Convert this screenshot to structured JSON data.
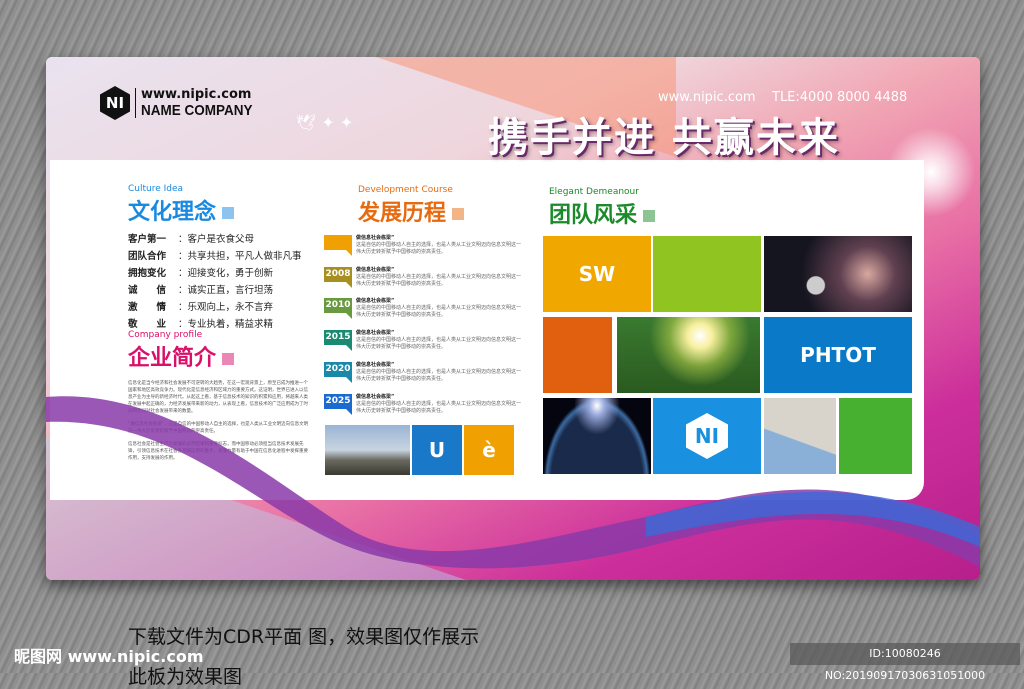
{
  "header": {
    "logo_mark": "NI",
    "website": "www.nipic.com",
    "company": "NAME COMPANY",
    "contact_site": "www.nipic.com",
    "tel": "TLE:4000 8000 4488",
    "slogan": "携手并进 共赢未来"
  },
  "culture": {
    "en": "Culture Idea",
    "title": "文化理念",
    "items": [
      {
        "k": "客户第一",
        "v": "：客户是衣食父母"
      },
      {
        "k": "团队合作",
        "v": "：共享共担，平凡人做非凡事"
      },
      {
        "k": "拥抱变化",
        "v": "：迎接变化，勇于创新"
      },
      {
        "k": "诚　　信",
        "v": "：诚实正直，言行坦荡"
      },
      {
        "k": "激　　情",
        "v": "：乐观向上，永不言弃"
      },
      {
        "k": "敬　　业",
        "v": "：专业执着，精益求精"
      }
    ]
  },
  "profile": {
    "en": "Company profile",
    "title": "企业简介",
    "paras": [
      "信息化是当今经济和社会发展不可逆转的大趋势，在这一宏观背景上，原至已成为推进一个国家和地区高效竞争力。现代化是信息经济和区域力的重要方式。这证明，世界已进入以信息产业为主导的新经济时代。从起这上看，基于信息技术的知识的积累和应用，将越来人类在发展中起正确的，力经济发展带来新的动力，从表现上看，信息技术的广泛应用成为了时间和空间对社会发展带来的数量。",
      "“做信息社会栋梁”，这是自信的中国移动人自主的选择，也是人类从工业文明迈向信息文明这一伟大历史转折赋予中国移动的崇高责任。",
      "信息社会是社会生产力发展的必然结果和重要标志，而中国移动必须担当信息技术发展先锋，引领信息技术在社会各领域应用的推手，发展力量有助于中国在信息化进程中发挥重要作用，支持发展的作用。"
    ]
  },
  "development": {
    "en": "Development Course",
    "title": "发展历程",
    "items": [
      {
        "year": "",
        "color": "#f0a000",
        "head": "做信息社会栋梁”",
        "body": "这是自信的中国移动人自主的选择，也是人类从工业文明迈向信息文明这一伟大历史转折赋予中国移动的崇高责任。"
      },
      {
        "year": "2008",
        "color": "#a89020",
        "head": "做信息社会栋梁”",
        "body": "这是自信的中国移动人自主的选择，也是人类从工业文明迈向信息文明这一伟大历史转折赋予中国移动的崇高责任。"
      },
      {
        "year": "2010",
        "color": "#6a9a40",
        "head": "做信息社会栋梁”",
        "body": "这是自信的中国移动人自主的选择，也是人类从工业文明迈向信息文明这一伟大历史转折赋予中国移动的崇高责任。"
      },
      {
        "year": "2015",
        "color": "#1a8a70",
        "head": "做信息社会栋梁”",
        "body": "这是自信的中国移动人自主的选择，也是人类从工业文明迈向信息文明这一伟大历史转折赋予中国移动的崇高责任。"
      },
      {
        "year": "2020",
        "color": "#1a88a8",
        "head": "做信息社会栋梁”",
        "body": "这是自信的中国移动人自主的选择，也是人类从工业文明迈向信息文明这一伟大历史转折赋予中国移动的崇高责任。"
      },
      {
        "year": "2025",
        "color": "#1a6ad0",
        "head": "做信息社会栋梁”",
        "body": "这是自信的中国移动人自主的选择，也是人类从工业文明迈向信息文明这一伟大历史转折赋予中国移动的崇高责任。"
      }
    ],
    "tile_u": "U",
    "tile_e": "è"
  },
  "team": {
    "en": "Elegant Demeanour",
    "title": "团队风采",
    "tile_sw": "SW",
    "tile_photo": "PHTOT",
    "logo_mark": "NI"
  },
  "colors": {
    "culture": "#1a8ae0",
    "development": "#e86a10",
    "profile": "#d8106a",
    "team": "#1a8a2a"
  },
  "footer": {
    "note": "下载文件为CDR平面 图，效果图仅作展示",
    "note2": "此板为效果图",
    "watermark": "昵图网 www.nipic.com",
    "id": "ID:10080246 NO:20190917030631051000"
  }
}
